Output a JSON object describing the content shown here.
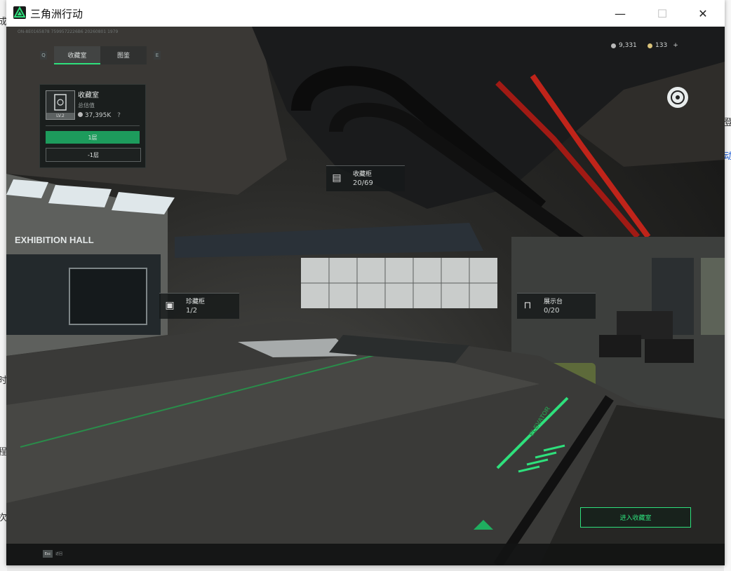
{
  "window": {
    "title": "三角洲行动",
    "controls": {
      "minimize": "—",
      "maximize": "☐",
      "close": "✕"
    }
  },
  "hud": {
    "session_id": "ON-8E0165878 7599572226B6 20260801 1979",
    "tabs": [
      {
        "label": "收藏室",
        "active": true
      },
      {
        "label": "图鉴",
        "active": false
      }
    ],
    "tab_prev": "Q",
    "tab_next": "E",
    "currency": [
      {
        "value": "9,331",
        "color": "#b9b9b9"
      },
      {
        "value": "133",
        "suffix": "+",
        "color": "#d9c27a"
      }
    ],
    "room_panel": {
      "title": "收藏室",
      "subtitle": "总估值",
      "value": "37,395K",
      "help": "?",
      "level": "LV.2",
      "floor_active": "1层",
      "floor_other": "-1层"
    },
    "labels": [
      {
        "name": "收藏柜",
        "count": "20/69",
        "icon": "cabinet-icon"
      },
      {
        "name": "珍藏柜",
        "count": "1/2",
        "icon": "treasure-cabinet-icon"
      },
      {
        "name": "展示台",
        "count": "0/20",
        "icon": "display-stand-icon"
      }
    ],
    "scene_signs": {
      "hall": "EXHIBITION HALL",
      "elevator": "ELEVATOR"
    },
    "enter_button": "进入收藏室",
    "esc_key": "Esc",
    "esc_label": "返回"
  },
  "background_page": {
    "left_glyphs": [
      "成",
      "时",
      "程",
      "次"
    ],
    "right_glyphs": [
      "登",
      "动"
    ]
  }
}
